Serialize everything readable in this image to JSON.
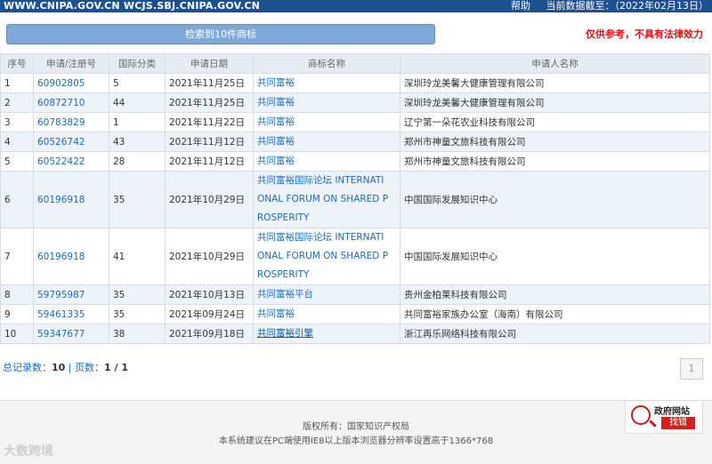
{
  "topbar": {
    "domains": "WWW.CNIPA.GOV.CN WCJS.SBJ.CNIPA.GOV.CN",
    "help": "帮助",
    "data_date": "当前数据截至：（2022年02月13日）"
  },
  "search": {
    "result_label": "检索到10件商标",
    "disclaimer": "仅供参考，不具有法律效力"
  },
  "table": {
    "headers": [
      "序号",
      "申请/注册号",
      "国际分类",
      "申请日期",
      "商标名称",
      "申请人名称"
    ],
    "rows": [
      {
        "no": "1",
        "reg": "60902805",
        "cls": "5",
        "date": "2021年11月25日",
        "name": "共同富裕",
        "applicant": "深圳玲龙美馨大健康管理有限公司"
      },
      {
        "no": "2",
        "reg": "60872710",
        "cls": "44",
        "date": "2021年11月25日",
        "name": "共同富裕",
        "applicant": "深圳玲龙美馨大健康管理有限公司"
      },
      {
        "no": "3",
        "reg": "60783829",
        "cls": "1",
        "date": "2021年11月22日",
        "name": "共同富裕",
        "applicant": "辽宁第一朵花农业科技有限公司"
      },
      {
        "no": "4",
        "reg": "60526742",
        "cls": "43",
        "date": "2021年11月12日",
        "name": "共同富裕",
        "applicant": "郑州市神童文旅科技有限公司"
      },
      {
        "no": "5",
        "reg": "60522422",
        "cls": "28",
        "date": "2021年11月12日",
        "name": "共同富裕",
        "applicant": "郑州市神童文旅科技有限公司"
      },
      {
        "no": "6",
        "reg": "60196918",
        "cls": "35",
        "date": "2021年10月29日",
        "name_lines": [
          "共同富裕国际论坛 INTERNATI",
          "ONAL FORUM ON SHARED P",
          "ROSPERITY"
        ],
        "applicant": "中国国际发展知识中心"
      },
      {
        "no": "7",
        "reg": "60196918",
        "cls": "41",
        "date": "2021年10月29日",
        "name_lines": [
          "共同富裕国际论坛 INTERNATI",
          "ONAL FORUM ON SHARED P",
          "ROSPERITY"
        ],
        "applicant": "中国国际发展知识中心"
      },
      {
        "no": "8",
        "reg": "59795987",
        "cls": "35",
        "date": "2021年10月13日",
        "name": "共同富裕平台",
        "applicant": "贵州金柏莱科技有限公司"
      },
      {
        "no": "9",
        "reg": "59461335",
        "cls": "35",
        "date": "2021年09月24日",
        "name": "共同富裕",
        "applicant": "共同富裕家族办公室（海南）有限公司"
      },
      {
        "no": "10",
        "reg": "59347677",
        "cls": "38",
        "date": "2021年09月18日",
        "name": "共同富裕引擎",
        "applicant": "浙江再乐网络科技有限公司"
      }
    ]
  },
  "pager": {
    "total_label": "总记录数：",
    "total": "10",
    "sep": " | ",
    "pages_label": "页数：",
    "pages": "1 / 1",
    "page_button": "1"
  },
  "footer": {
    "copyright": "版权所有：国家知识产权局",
    "note": "本系统建议在PC端使用IE8以上版本浏览器分辨率设置高于1366*768"
  },
  "gov_badge": {
    "title": "政府网站",
    "action": "找错",
    "icon": "magnifier-icon",
    "color": "#d21f1f"
  },
  "watermark": "大数跨境"
}
